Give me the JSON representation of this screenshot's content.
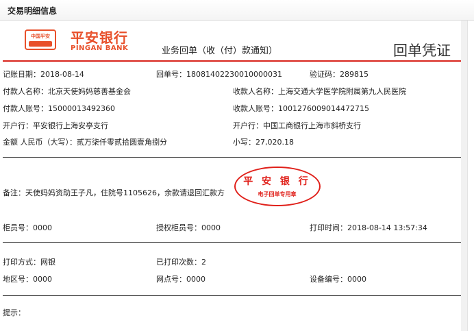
{
  "header": {
    "title": "交易明细信息"
  },
  "bank": {
    "logo_text": "中国平安",
    "name_cn": "平安银行",
    "name_en": "PINGAN BANK"
  },
  "receipt": {
    "notice": "业务回单（收（付）款通知）",
    "voucher_title": "回单凭证",
    "fields": {
      "booking_date": "记账日期：2018-08-14",
      "receipt_no": "回单号：18081402230010000031",
      "verify_code": "验证码：289815",
      "payer_name": "付款人名称：北京天使妈妈慈善基金会",
      "payee_name": "收款人名称：上海交通大学医学院附属第九人民医院",
      "payer_account": "付款人账号：15000013492360",
      "payee_account": "收款人账号：1001276009014472715",
      "payer_bank": "开户行：平安银行上海安亭支行",
      "payee_bank": "开户行：中国工商银行上海市斜桥支行",
      "amount_words": "金额 人民币（大写）：贰万柒仟零贰拾圆壹角捌分",
      "amount_small": "小写：27,020.18",
      "remark": "备注：天使妈妈资助王子凡，住院号1105626，余款请退回汇款方",
      "teller_no": "柜员号：0000",
      "auth_teller_no": "授权柜员号：0000",
      "print_time": "打印时间：2018-08-14 13:57:34",
      "print_method": "打印方式：网银",
      "print_count": "已打印次数：2",
      "area_no": "地区号：0000",
      "branch_no": "网点号：0000",
      "device_no": "设备编号：0000",
      "hint": "提示："
    }
  },
  "stamp": {
    "line1": "平 安 银 行",
    "line2": "电子回单专用章"
  },
  "colors": {
    "brand": "#e8502b",
    "stamp": "#e0201a",
    "rule": "#d9251d"
  }
}
